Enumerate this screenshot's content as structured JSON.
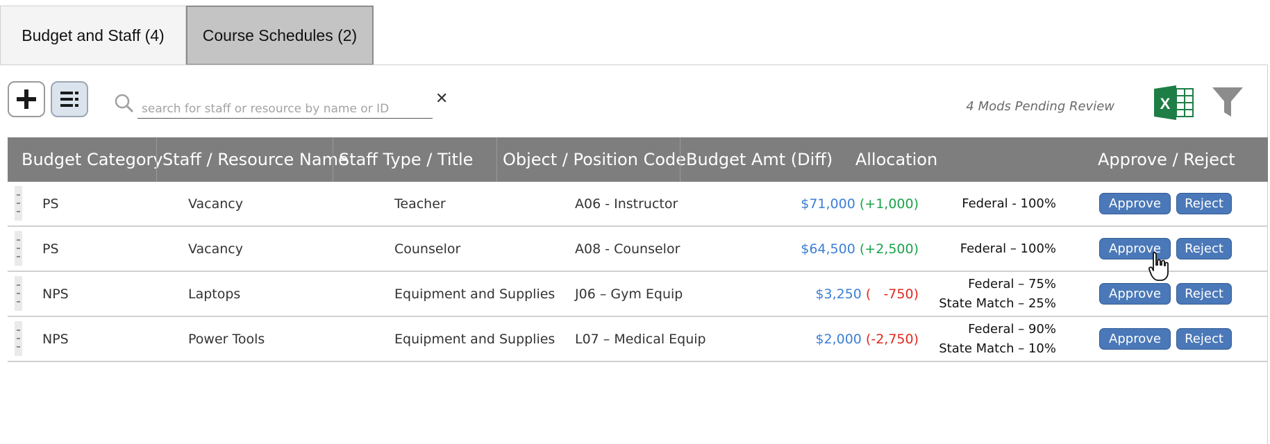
{
  "tabs": [
    {
      "label": "Budget and Staff (4)",
      "active": true
    },
    {
      "label": "Course Schedules (2)",
      "active": false
    }
  ],
  "toolbar": {
    "add_icon": "plus-icon",
    "list_icon": "list-icon",
    "search_placeholder": "search for staff or resource by name or ID",
    "search_value": "",
    "clear_icon": "close-icon",
    "pending_text": "4 Mods Pending Review",
    "excel_letter": "X",
    "excel_icon": "excel-icon",
    "filter_icon": "filter-icon"
  },
  "table": {
    "headers": [
      "Budget Category",
      "Staff / Resource Name",
      "Staff Type / Title",
      "Object / Position Code",
      "Budget Amt (Diff)",
      "Allocation",
      "Approve / Reject"
    ],
    "rows": [
      {
        "category": "PS",
        "name": "Vacancy",
        "type": "Teacher",
        "code": "A06 - Instructor",
        "amount": "$71,000",
        "diff": "(+1,000)",
        "diff_sign": "positive",
        "allocation": [
          "Federal - 100%"
        ],
        "approve": "Approve",
        "reject": "Reject"
      },
      {
        "category": "PS",
        "name": "Vacancy",
        "type": "Counselor",
        "code": "A08 - Counselor",
        "amount": "$64,500",
        "diff": "(+2,500)",
        "diff_sign": "positive",
        "allocation": [
          "Federal – 100%"
        ],
        "approve": "Approve",
        "reject": "Reject"
      },
      {
        "category": "NPS",
        "name": "Laptops",
        "type": "Equipment and Supplies",
        "code": "J06 – Gym Equip",
        "amount": "$3,250",
        "diff": "(   -750)",
        "diff_sign": "negative",
        "allocation": [
          "Federal – 75%",
          "State Match – 25%"
        ],
        "approve": "Approve",
        "reject": "Reject"
      },
      {
        "category": "NPS",
        "name": "Power Tools",
        "type": "Equipment and Supplies",
        "code": "L07 – Medical Equip",
        "amount": "$2,000",
        "diff": "(-2,750)",
        "diff_sign": "negative",
        "allocation": [
          "Federal – 90%",
          "State Match – 10%"
        ],
        "approve": "Approve",
        "reject": "Reject"
      }
    ]
  },
  "colors": {
    "header_bg": "#7e7e7e",
    "amount": "#3c7fd6",
    "positive": "#1aa34a",
    "negative": "#e0281e",
    "button": "#4a78b8",
    "excel_green": "#1e7e45"
  },
  "cursor_icon": "hand-pointer-icon"
}
